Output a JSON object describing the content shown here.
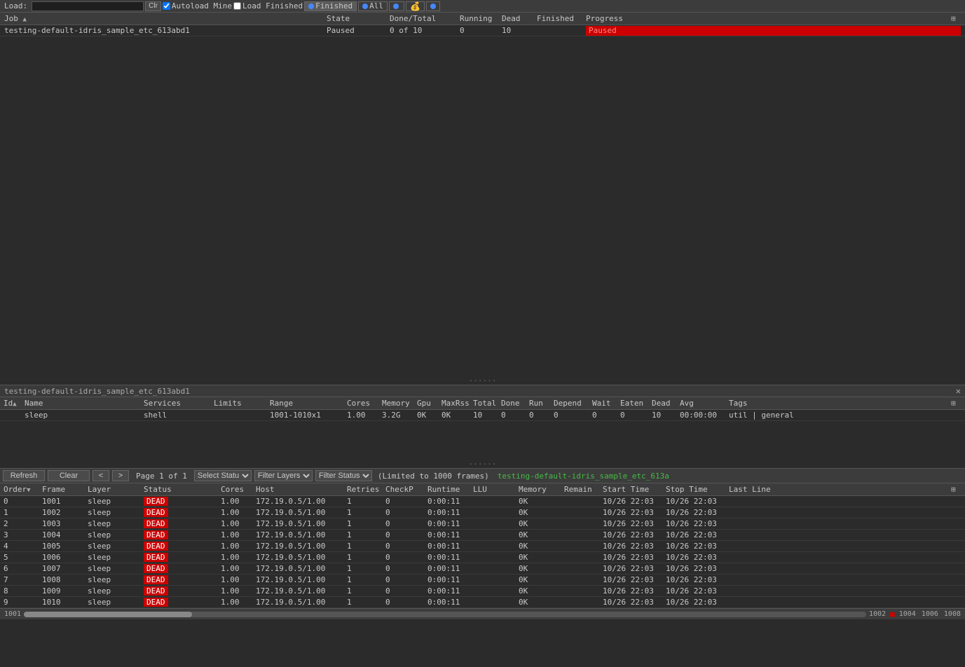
{
  "toolbar": {
    "load_label": "Load:",
    "clr_label": "Clr",
    "autoload_mine_label": "Autoload Mine",
    "load_finished_label": "Load Finished",
    "finished_label": "Finished",
    "all_label": "All",
    "dot1_color": "#4488ff",
    "dot2_color": "#4488ff",
    "pac_icon": "●"
  },
  "job_table": {
    "columns": [
      {
        "id": "job",
        "label": "Job"
      },
      {
        "id": "state",
        "label": "State"
      },
      {
        "id": "done_total",
        "label": "Done/Total"
      },
      {
        "id": "running",
        "label": "Running"
      },
      {
        "id": "dead",
        "label": "Dead"
      },
      {
        "id": "finished",
        "label": "Finished"
      },
      {
        "id": "progress",
        "label": "Progress"
      }
    ],
    "rows": [
      {
        "job": "testing-default-idris_sample_etc_613abd1",
        "state": "Paused",
        "done_total": "0 of 10",
        "running": "0",
        "dead": "10",
        "finished": "",
        "progress": "Paused"
      }
    ]
  },
  "layer_panel": {
    "title": "testing-default-idris_sample_etc_613abd1",
    "columns": [
      "Id",
      "Name",
      "Services",
      "Limits",
      "Range",
      "Cores",
      "Memory",
      "Gpu",
      "MaxRss",
      "Total",
      "Done",
      "Run",
      "Depend",
      "Wait",
      "Eaten",
      "Dead",
      "Avg",
      "Tags"
    ],
    "rows": [
      {
        "id": "",
        "name": "sleep",
        "services": "shell",
        "limits": "",
        "range": "1001-1010x1",
        "cores": "1.00",
        "memory": "3.2G",
        "gpu": "0K",
        "maxrss": "0K",
        "total": "10",
        "done": "0",
        "run": "0",
        "depend": "0",
        "wait": "0",
        "eaten": "0",
        "dead": "10",
        "avg": "00:00:00",
        "tags": "util | general"
      }
    ]
  },
  "frame_toolbar": {
    "refresh_label": "Refresh",
    "clear_label": "Clear",
    "prev_label": "<",
    "next_label": ">",
    "page_info": "Page 1 of 1",
    "select_status_label": "Select Statu",
    "filter_layers_label": "Filter Layers",
    "filter_status_label": "Filter Status",
    "limit_info": "(Limited to 1000 frames)",
    "job_name": "testing-default-idris_sample_etc_613a"
  },
  "frame_table": {
    "columns": [
      "Order",
      "Frame",
      "Layer",
      "Status",
      "Cores",
      "Host",
      "Retries",
      "CheckP",
      "Runtime",
      "LLU",
      "Memory",
      "Remain",
      "Start Time",
      "Stop Time",
      "Last Line"
    ],
    "rows": [
      {
        "order": "0",
        "frame": "1001",
        "layer": "sleep",
        "status": "DEAD",
        "cores": "1.00",
        "host": "172.19.0.5/1.00",
        "retries": "1",
        "checkp": "0",
        "runtime": "0:00:11",
        "llu": "",
        "memory": "0K",
        "remain": "",
        "start": "10/26 22:03",
        "stop": "10/26 22:03",
        "lastline": ""
      },
      {
        "order": "1",
        "frame": "1002",
        "layer": "sleep",
        "status": "DEAD",
        "cores": "1.00",
        "host": "172.19.0.5/1.00",
        "retries": "1",
        "checkp": "0",
        "runtime": "0:00:11",
        "llu": "",
        "memory": "0K",
        "remain": "",
        "start": "10/26 22:03",
        "stop": "10/26 22:03",
        "lastline": ""
      },
      {
        "order": "2",
        "frame": "1003",
        "layer": "sleep",
        "status": "DEAD",
        "cores": "1.00",
        "host": "172.19.0.5/1.00",
        "retries": "1",
        "checkp": "0",
        "runtime": "0:00:11",
        "llu": "",
        "memory": "0K",
        "remain": "",
        "start": "10/26 22:03",
        "stop": "10/26 22:03",
        "lastline": ""
      },
      {
        "order": "3",
        "frame": "1004",
        "layer": "sleep",
        "status": "DEAD",
        "cores": "1.00",
        "host": "172.19.0.5/1.00",
        "retries": "1",
        "checkp": "0",
        "runtime": "0:00:11",
        "llu": "",
        "memory": "0K",
        "remain": "",
        "start": "10/26 22:03",
        "stop": "10/26 22:03",
        "lastline": ""
      },
      {
        "order": "4",
        "frame": "1005",
        "layer": "sleep",
        "status": "DEAD",
        "cores": "1.00",
        "host": "172.19.0.5/1.00",
        "retries": "1",
        "checkp": "0",
        "runtime": "0:00:11",
        "llu": "",
        "memory": "0K",
        "remain": "",
        "start": "10/26 22:03",
        "stop": "10/26 22:03",
        "lastline": ""
      },
      {
        "order": "5",
        "frame": "1006",
        "layer": "sleep",
        "status": "DEAD",
        "cores": "1.00",
        "host": "172.19.0.5/1.00",
        "retries": "1",
        "checkp": "0",
        "runtime": "0:00:11",
        "llu": "",
        "memory": "0K",
        "remain": "",
        "start": "10/26 22:03",
        "stop": "10/26 22:03",
        "lastline": ""
      },
      {
        "order": "6",
        "frame": "1007",
        "layer": "sleep",
        "status": "DEAD",
        "cores": "1.00",
        "host": "172.19.0.5/1.00",
        "retries": "1",
        "checkp": "0",
        "runtime": "0:00:11",
        "llu": "",
        "memory": "0K",
        "remain": "",
        "start": "10/26 22:03",
        "stop": "10/26 22:03",
        "lastline": ""
      },
      {
        "order": "7",
        "frame": "1008",
        "layer": "sleep",
        "status": "DEAD",
        "cores": "1.00",
        "host": "172.19.0.5/1.00",
        "retries": "1",
        "checkp": "0",
        "runtime": "0:00:11",
        "llu": "",
        "memory": "0K",
        "remain": "",
        "start": "10/26 22:03",
        "stop": "10/26 22:03",
        "lastline": ""
      },
      {
        "order": "8",
        "frame": "1009",
        "layer": "sleep",
        "status": "DEAD",
        "cores": "1.00",
        "host": "172.19.0.5/1.00",
        "retries": "1",
        "checkp": "0",
        "runtime": "0:00:11",
        "llu": "",
        "memory": "0K",
        "remain": "",
        "start": "10/26 22:03",
        "stop": "10/26 22:03",
        "lastline": ""
      },
      {
        "order": "9",
        "frame": "1010",
        "layer": "sleep",
        "status": "DEAD",
        "cores": "1.00",
        "host": "172.19.0.5/1.00",
        "retries": "1",
        "checkp": "0",
        "runtime": "0:00:11",
        "llu": "",
        "memory": "0K",
        "remain": "",
        "start": "10/26 22:03",
        "stop": "10/26 22:03",
        "lastline": ""
      }
    ]
  },
  "bottom_scrollbar": {
    "labels": [
      "1001",
      "1002",
      "1004",
      "1006",
      "1008"
    ],
    "red_indicator": "■"
  }
}
